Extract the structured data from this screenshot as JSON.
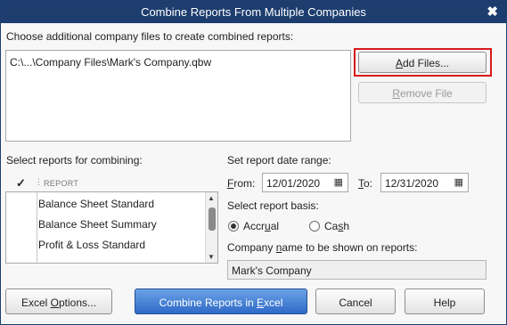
{
  "window": {
    "title": "Combine Reports From Multiple Companies",
    "close_glyph": "✖"
  },
  "files": {
    "label": "Choose additional company files to create combined reports:",
    "items": [
      "C:\\...\\Company Files\\Mark's Company.qbw"
    ],
    "add_button": {
      "before": "",
      "mnemonic": "A",
      "after": "dd Files..."
    },
    "remove_button": {
      "before": "",
      "mnemonic": "R",
      "after": "emove File"
    }
  },
  "reports": {
    "label": "Select reports for combining:",
    "check_header": "✓",
    "column_header": "REPORT",
    "items": [
      "Balance Sheet Standard",
      "Balance Sheet Summary",
      "Profit & Loss Standard"
    ]
  },
  "date_range": {
    "label": "Set report date range:",
    "from": {
      "mnemonic": "F",
      "after": "rom:",
      "value": "12/01/2020"
    },
    "to": {
      "mnemonic": "T",
      "after": "o:",
      "value": "12/31/2020"
    }
  },
  "basis": {
    "label": "Select report basis:",
    "accrual": {
      "before": "Accr",
      "mnemonic": "u",
      "after": "al",
      "selected": true
    },
    "cash": {
      "before": "Ca",
      "mnemonic": "s",
      "after": "h",
      "selected": false
    }
  },
  "company_name": {
    "label_before": "Company ",
    "label_mnemonic": "n",
    "label_after": "ame to be shown on reports:",
    "value": "Mark's Company"
  },
  "buttons": {
    "excel_options": {
      "before": "Excel ",
      "mnemonic": "O",
      "after": "ptions..."
    },
    "combine": {
      "before": "Combine Reports in ",
      "mnemonic": "E",
      "after": "xcel"
    },
    "cancel": "Cancel",
    "help": "Help"
  },
  "colors": {
    "titlebar": "#1c3d6e",
    "highlight": "#d61a1a",
    "primary_button": "#2f6ac8"
  },
  "icons": {
    "calendar": "calendar-icon",
    "close": "close-icon"
  }
}
